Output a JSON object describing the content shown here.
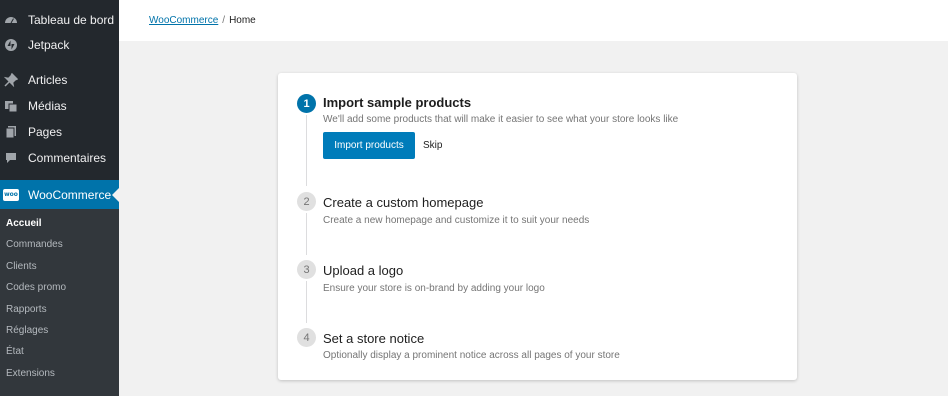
{
  "sidebar": {
    "items": [
      {
        "label": "Tableau de bord",
        "icon": "dashboard-icon"
      },
      {
        "label": "Jetpack",
        "icon": "jetpack-icon"
      },
      {
        "label": "Articles",
        "icon": "pin-icon"
      },
      {
        "label": "Médias",
        "icon": "media-icon"
      },
      {
        "label": "Pages",
        "icon": "pages-icon"
      },
      {
        "label": "Commentaires",
        "icon": "comments-icon"
      }
    ],
    "active": {
      "label": "WooCommerce",
      "icon": "woocommerce-icon",
      "icon_text": "woo"
    },
    "submenu": [
      "Accueil",
      "Commandes",
      "Clients",
      "Codes promo",
      "Rapports",
      "Réglages",
      "État",
      "Extensions"
    ],
    "current_submenu": "Accueil"
  },
  "breadcrumb": {
    "link": "WooCommerce",
    "separator": "/",
    "current": "Home"
  },
  "steps": [
    {
      "number": "1",
      "title": "Import sample products",
      "description": "We'll add some products that will make it easier to see what your store looks like",
      "primary_button": "Import products",
      "secondary_button": "Skip"
    },
    {
      "number": "2",
      "title": "Create a custom homepage",
      "description": "Create a new homepage and customize it to suit your needs"
    },
    {
      "number": "3",
      "title": "Upload a logo",
      "description": "Ensure your store is on-brand by adding your logo"
    },
    {
      "number": "4",
      "title": "Set a store notice",
      "description": "Optionally display a prominent notice across all pages of your store"
    }
  ],
  "colors": {
    "sidebar_bg": "#23282d",
    "accent": "#0073aa",
    "button": "#007cba"
  }
}
